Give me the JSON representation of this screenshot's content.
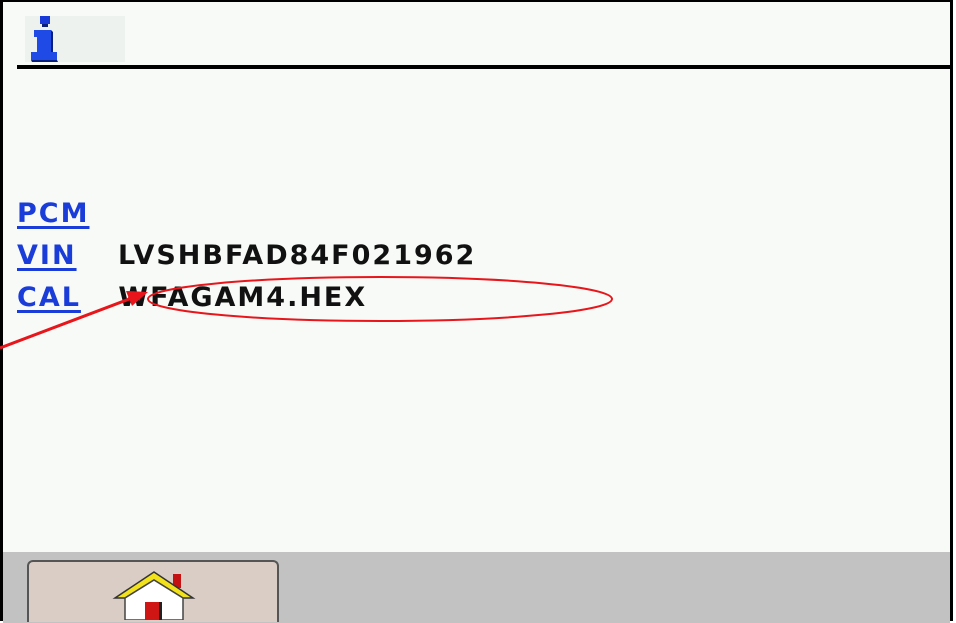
{
  "header": {
    "icon": "info-icon"
  },
  "fields": [
    {
      "label": "PCM",
      "value": ""
    },
    {
      "label": "VIN",
      "value": "LVSHBFAD84F021962"
    },
    {
      "label": "CAL",
      "value": "WFAGAM4.HEX"
    }
  ],
  "annotation": {
    "shape": "ellipse",
    "color": "#e8151b",
    "target": "CAL value",
    "arrow": true
  },
  "toolbar": {
    "home_icon": "home-icon"
  },
  "colors": {
    "background": "#f7faf7",
    "link": "#1a3cd9",
    "toolbar": "#c2c2c2",
    "button": "#d9cdc5",
    "annotation": "#e8151b"
  }
}
